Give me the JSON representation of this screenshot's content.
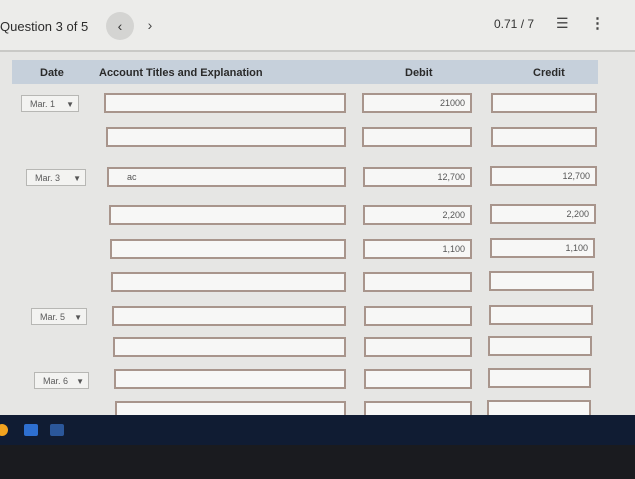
{
  "header": {
    "question_label": "Question 3 of 5",
    "prev_icon": "chevron-left-icon",
    "next_icon": "chevron-right-icon",
    "prev_glyph": "‹",
    "next_glyph": "›",
    "score": "0.71 / 7",
    "list_glyph": "☰",
    "more_glyph": "⋮"
  },
  "table": {
    "columns": {
      "date": "Date",
      "account": "Account Titles and Explanation",
      "debit": "Debit",
      "credit": "Credit"
    },
    "rows": [
      {
        "date": "Mar. 1",
        "account": "",
        "debit": "21000",
        "credit": ""
      },
      {
        "date": "",
        "account": "",
        "debit": "",
        "credit": ""
      },
      {
        "date": "Mar. 3",
        "account": "ac",
        "debit": "12,700",
        "credit": "12,700"
      },
      {
        "date": "",
        "account": "",
        "debit": "2,200",
        "credit": "2,200"
      },
      {
        "date": "",
        "account": "",
        "debit": "1,100",
        "credit": "1,100"
      },
      {
        "date": "",
        "account": "",
        "debit": "",
        "credit": ""
      },
      {
        "date": "Mar. 5",
        "account": "",
        "debit": "",
        "credit": ""
      },
      {
        "date": "",
        "account": "",
        "debit": "",
        "credit": ""
      },
      {
        "date": "Mar. 6",
        "account": "",
        "debit": "",
        "credit": ""
      }
    ]
  },
  "colors": {
    "header_bg": "#c6d0db",
    "field_border": "#a8958c",
    "taskbar_bg": "#101c33"
  }
}
